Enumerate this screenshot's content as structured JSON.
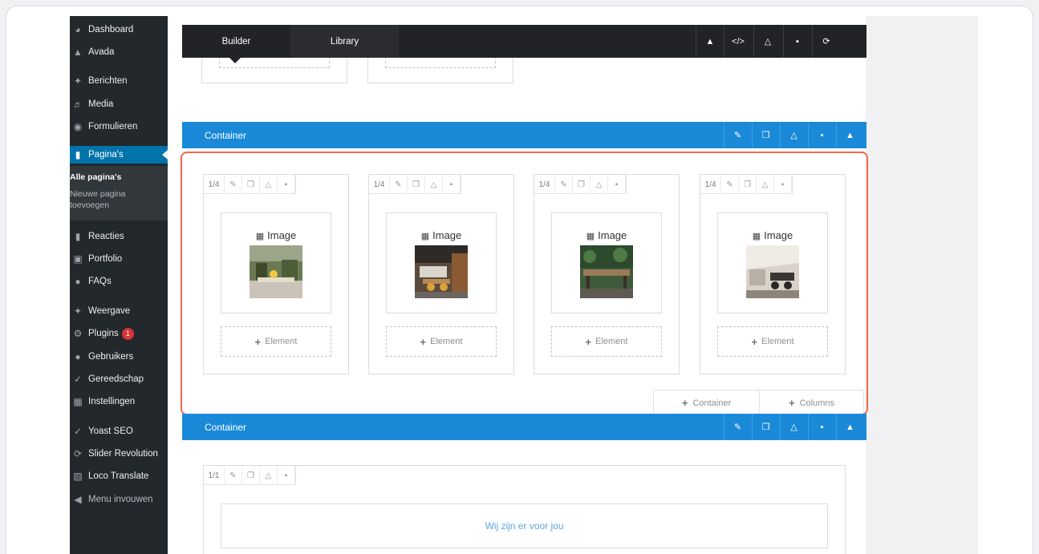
{
  "builder_bar": {
    "tabs": [
      "Builder",
      "Library"
    ],
    "buttons": [
      "collapse-icon",
      "code-icon",
      "save-icon",
      "trash-icon",
      "history-icon"
    ]
  },
  "sidebar": {
    "items": [
      {
        "label": "Dashboard",
        "icon": "dashboard-icon"
      },
      {
        "label": "Avada",
        "icon": "avada-icon"
      },
      {
        "label": "Berichten",
        "icon": "pin-icon"
      },
      {
        "label": "Media",
        "icon": "media-icon"
      },
      {
        "label": "Formulieren",
        "icon": "forms-icon"
      },
      {
        "label": "Pagina's",
        "icon": "page-icon"
      },
      {
        "label": "Reacties",
        "icon": "comment-icon"
      },
      {
        "label": "Portfolio",
        "icon": "portfolio-icon"
      },
      {
        "label": "FAQs",
        "icon": "faq-icon"
      },
      {
        "label": "Weergave",
        "icon": "brush-icon"
      },
      {
        "label": "Plugins",
        "icon": "plugin-icon",
        "badge": "1"
      },
      {
        "label": "Gebruikers",
        "icon": "users-icon"
      },
      {
        "label": "Gereedschap",
        "icon": "wrench-icon"
      },
      {
        "label": "Instellingen",
        "icon": "settings-icon"
      },
      {
        "label": "Yoast SEO",
        "icon": "yoast-icon"
      },
      {
        "label": "Slider Revolution",
        "icon": "slider-icon"
      },
      {
        "label": "Loco Translate",
        "icon": "translate-icon"
      },
      {
        "label": "Menu invouwen",
        "icon": "collapse-menu-icon"
      }
    ],
    "submenu": {
      "current": "Alle pagina's",
      "new_line1": "Nieuwe pagina",
      "new_line2": "toevoegen"
    }
  },
  "containers": {
    "label": "Container",
    "controls": [
      "edit-icon",
      "clone-icon",
      "save-icon",
      "trash-icon",
      "collapse-icon"
    ]
  },
  "columns": [
    {
      "size": "1/4",
      "element": "Image",
      "add_label": "Element"
    },
    {
      "size": "1/4",
      "element": "Image",
      "add_label": "Element"
    },
    {
      "size": "1/4",
      "element": "Image",
      "add_label": "Element"
    },
    {
      "size": "1/4",
      "element": "Image",
      "add_label": "Element"
    }
  ],
  "footer_buttons": {
    "container": "Container",
    "columns": "Columns"
  },
  "bottom": {
    "col_size": "1/1",
    "text_element": "Wij zijn er voor jou"
  },
  "colors": {
    "accent_blue": "#1a8ad8",
    "highlight": "#f2674a",
    "sidebar_bg": "#23282d",
    "active_menu": "#0073aa"
  }
}
